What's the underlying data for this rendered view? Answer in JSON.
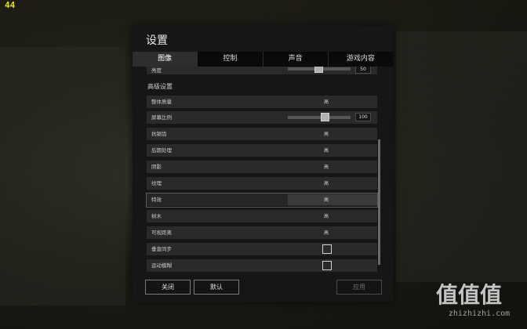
{
  "overlay": {
    "fps": "44"
  },
  "dialog": {
    "title": "设置",
    "tabs": [
      "图像",
      "控制",
      "声音",
      "游戏内容"
    ],
    "active_tab": "图像",
    "brightness": {
      "label": "亮度",
      "value": "50",
      "level": 0.5
    },
    "section_title": "高级设置",
    "rows": [
      {
        "label": "整体质量",
        "value": "高"
      },
      {
        "label": "屏幕比例",
        "value": "100",
        "level": 0.6
      },
      {
        "label": "抗锯齿",
        "value": "高"
      },
      {
        "label": "后期处理",
        "value": "高"
      },
      {
        "label": "阴影",
        "value": "高"
      },
      {
        "label": "纹理",
        "value": "高"
      },
      {
        "label": "特效",
        "value": "高"
      },
      {
        "label": "树木",
        "value": "高"
      },
      {
        "label": "可视距离",
        "value": "高"
      },
      {
        "label": "垂直同步",
        "checked": false
      },
      {
        "label": "运动模糊",
        "checked": false
      }
    ],
    "buttons": {
      "close": "关闭",
      "default": "默认",
      "apply": "应用"
    }
  },
  "watermark": {
    "glyphs": "值值值",
    "domain": "zhizhizhi.com"
  }
}
